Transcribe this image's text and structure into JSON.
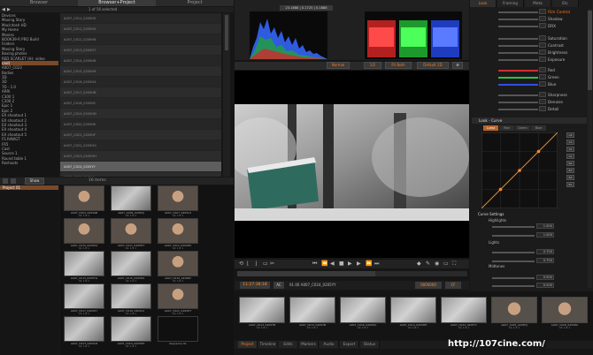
{
  "left_tabs": [
    "Browser",
    "Browser+Project",
    "Project"
  ],
  "left_tabs_active": 1,
  "selection_info": "1 of 56 selected",
  "tree_rows": [
    {
      "label": "Devices",
      "sel": false
    },
    {
      "label": "Moving Story",
      "sel": false
    },
    {
      "label": "Macintosh HD",
      "sel": false
    },
    {
      "label": "My Home",
      "sel": false
    },
    {
      "label": "Movies",
      "sel": false
    },
    {
      "label": "BOOK39-R PRO Build",
      "sel": false
    },
    {
      "label": "Folders",
      "sel": false
    },
    {
      "label": "Moving Story",
      "sel": false
    },
    {
      "label": "Boxing photos",
      "sel": false
    },
    {
      "label": "RED SCARLET (H): video",
      "sel": false
    },
    {
      "label": "card",
      "sel": true
    },
    {
      "label": "A007_C023",
      "sel": false
    },
    {
      "label": "Bodies",
      "sel": false
    },
    {
      "label": "3D",
      "sel": false
    },
    {
      "label": "3D",
      "sel": false
    },
    {
      "label": "7D - 1.0",
      "sel": false
    },
    {
      "label": "ARRI",
      "sel": false
    },
    {
      "label": "C300 1",
      "sel": false
    },
    {
      "label": "C300 2",
      "sel": false
    },
    {
      "label": "Epic 1",
      "sel": false
    },
    {
      "label": "Epic 2",
      "sel": false
    },
    {
      "label": "EX shootout 1",
      "sel": false
    },
    {
      "label": "EX shootout 2",
      "sel": false
    },
    {
      "label": "EX shootout 3",
      "sel": false
    },
    {
      "label": "EX shootout 4",
      "sel": false
    },
    {
      "label": "EX shootout 5",
      "sel": false
    },
    {
      "label": "FS RAWGT",
      "sel": false
    },
    {
      "label": "F65",
      "sel": false
    },
    {
      "label": "Cast",
      "sel": false
    },
    {
      "label": "Source 1",
      "sel": false
    },
    {
      "label": "Round table 1",
      "sel": false
    },
    {
      "label": "Reshoots",
      "sel": false
    }
  ],
  "file_list": [
    {
      "name": "A007_C011_0205H5",
      "sel": false
    },
    {
      "name": "A007_C011_0205H5",
      "sel": false
    },
    {
      "name": "A007_C012_0205H6",
      "sel": false
    },
    {
      "name": "A007_C013_0205H7",
      "sel": false
    },
    {
      "name": "A007_C014_0205H8",
      "sel": false
    },
    {
      "name": "A007_C015_0205H9",
      "sel": false
    },
    {
      "name": "A007_C016_0205HA",
      "sel": false
    },
    {
      "name": "A007_C017_0205HB",
      "sel": false
    },
    {
      "name": "A007_C018_0205HC",
      "sel": false
    },
    {
      "name": "A007_C019_0205HD",
      "sel": false
    },
    {
      "name": "A007_C020_0205HE",
      "sel": false
    },
    {
      "name": "A007_C021_0205HF",
      "sel": false
    },
    {
      "name": "A007_C022_0205HG",
      "sel": false
    },
    {
      "name": "A007_C023_0205HH",
      "sel": false
    },
    {
      "name": "A007_C024_0205YY",
      "sel": true
    },
    {
      "name": "A007_C025_0205HJ",
      "sel": false
    },
    {
      "name": "A007_C026_0205HK",
      "sel": false
    }
  ],
  "project_toolbar": {
    "view": "Show",
    "count": "16 items"
  },
  "project_item": "Project 01",
  "thumbs": [
    {
      "name": "A007_C003_0205SB",
      "date": "4K 1.8:1",
      "kind": "face"
    },
    {
      "name": "A007_C006_0205HJ",
      "date": "4K 1.8:1",
      "kind": "snow"
    },
    {
      "name": "A007_C007_0205C2",
      "date": "4K 1.8:1",
      "kind": "face"
    },
    {
      "name": "A007_C010_0205H4",
      "date": "4K 1.8:1",
      "kind": "face"
    },
    {
      "name": "A007_C011_0205HT",
      "date": "4K 1.8:1",
      "kind": "face"
    },
    {
      "name": "A007_C012_0205HK",
      "date": "4K 1.8:1",
      "kind": "face"
    },
    {
      "name": "A007_C013_0205TG",
      "date": "4K 1.8:1",
      "kind": "snow"
    },
    {
      "name": "A007_C015_0205H4",
      "date": "4K 1.8:1",
      "kind": "snow"
    },
    {
      "name": "A007_C016_0205RT",
      "date": "4K 1.8:1",
      "kind": "face"
    },
    {
      "name": "A007_C017_0205HY",
      "date": "2K 1.8:1",
      "kind": "snow"
    },
    {
      "name": "A007_C018_0205C2",
      "date": "2K 1.8:1",
      "kind": "snow"
    },
    {
      "name": "A007_C021_0205HT",
      "date": "2K 1.8:1",
      "kind": "face"
    },
    {
      "name": "A007_C023_0205C8",
      "date": "4K 1.8:1",
      "kind": "snow"
    },
    {
      "name": "A007_C024_0205HH",
      "date": "4K 1.8:1",
      "kind": "snow"
    },
    {
      "name": "Sequence 01",
      "date": "",
      "kind": "blank"
    }
  ],
  "scope_timecode": "23.1888 | 0.1725 | 0.1888",
  "viewer_controls": {
    "mode": "Normal",
    "res": "1/2",
    "fit": "Fit Both",
    "lut": "Default 2D"
  },
  "transport": {
    "timecode": "11:27:38:18",
    "flag": "AC",
    "clip": "01.00 A007_C024_0205YY",
    "end_tc": "0000000",
    "cf": "CF"
  },
  "bottom_tabs": [
    "Project",
    "Timeline",
    "Edits",
    "Markers",
    "Audio",
    "Export",
    "Status"
  ],
  "bottom_tabs_active": 0,
  "strip_clips": [
    {
      "name": "A007_C013_0205TB",
      "date": "4K 1.8:1",
      "kind": "snow"
    },
    {
      "name": "A007_C013_0205TB",
      "date": "4K 1.8:1",
      "kind": "snow"
    },
    {
      "name": "A007_C016_0205HA",
      "date": "4K 1.8:1",
      "kind": "snow"
    },
    {
      "name": "A007_C019_0205HH",
      "date": "4K 1.8:1",
      "kind": "snow"
    },
    {
      "name": "A007_C024_0205YY",
      "date": "4K 1.8:1",
      "kind": "snow"
    },
    {
      "name": "A007_C025_0205HJ",
      "date": "4K 1.8:1",
      "kind": "face"
    },
    {
      "name": "A007_C026_0205HK",
      "date": "4K 1.8:1",
      "kind": "face"
    }
  ],
  "right_tabs": [
    "Look",
    "Framing",
    "Meta",
    "Etc"
  ],
  "right_tabs_active": 0,
  "look_labels": [
    "Film Control",
    "Shadow",
    "DRX",
    "Saturation",
    "Contrast",
    "Brightness",
    "Exposure",
    "Red",
    "Green",
    "Blue",
    "Sharpness",
    "Denoise",
    "Detail"
  ],
  "curve_header": "Look - Curve",
  "curve_buttons": [
    "Luma",
    "Red",
    "Green",
    "Blue"
  ],
  "curve_side": [
    "A4",
    "A3",
    "A2",
    "A1",
    "B4",
    "B3",
    "B2",
    "B1"
  ],
  "curve_settings": {
    "header": "Curve Settings",
    "highlights": "Highlights",
    "lights": "Lights",
    "midtones": "Midtones",
    "v1": "1.000",
    "v2": "1.000",
    "v3": "0.750",
    "v4": "0.750",
    "v5": "0.500",
    "v6": "0.500"
  },
  "watermark": "http://107cine.com/",
  "colors": {
    "accent": "#ff7a1a",
    "selection": "#7a4a2a"
  }
}
